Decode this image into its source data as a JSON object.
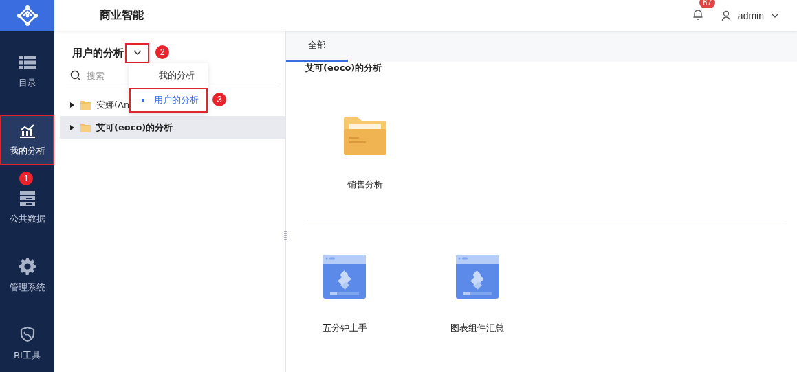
{
  "app": {
    "title": "商业智能"
  },
  "header": {
    "notifications": {
      "count": "67"
    },
    "user": {
      "name": "admin"
    }
  },
  "sidebar": {
    "items": [
      {
        "label": "目录",
        "kind": "list",
        "selected": false
      },
      {
        "label": "我的分析",
        "kind": "chart",
        "selected": true
      },
      {
        "label": "公共数据",
        "kind": "storage",
        "selected": false
      },
      {
        "label": "管理系统",
        "kind": "gear",
        "selected": false
      },
      {
        "label": "BI工具",
        "kind": "tool",
        "selected": false
      }
    ]
  },
  "panel": {
    "title": "用户的分析",
    "search": {
      "placeholder": "搜索"
    },
    "tree": [
      {
        "label": "安娜(An",
        "selected": false,
        "expanded": false
      },
      {
        "label": "艾可(eoco)的分析",
        "selected": true,
        "expanded": false
      }
    ]
  },
  "dropdown": {
    "items": [
      {
        "label": "我的分析",
        "selected": false
      },
      {
        "label": "用户的分析",
        "selected": true
      }
    ]
  },
  "content": {
    "tabs": [
      {
        "label": "全部",
        "selected": true
      }
    ],
    "sections": [
      {
        "title": "艾可(eoco)的分析",
        "items": [
          {
            "label": "销售分析",
            "kind": "folder"
          }
        ]
      },
      {
        "items": [
          {
            "label": "五分钟上手",
            "kind": "template"
          },
          {
            "label": "图表组件汇总",
            "kind": "template"
          }
        ]
      }
    ]
  },
  "annotations": [
    {
      "number": "1",
      "kind": "sidebar"
    },
    {
      "number": "2",
      "kind": "toggle"
    },
    {
      "number": "3",
      "kind": "menu"
    }
  ]
}
